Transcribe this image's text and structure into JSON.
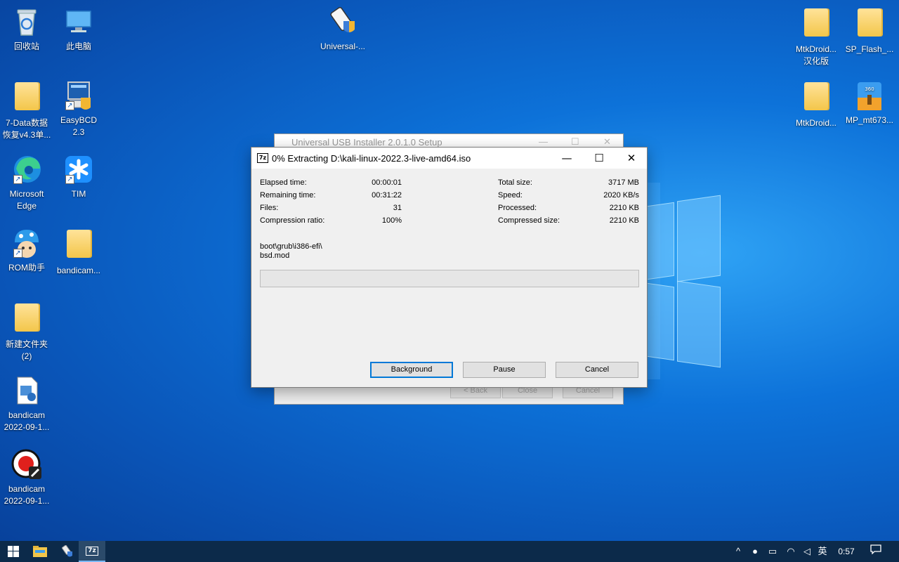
{
  "desktop": {
    "icons": [
      {
        "label": "回收站"
      },
      {
        "label": "此电脑"
      },
      {
        "label": "Universal-..."
      },
      {
        "label": "MtkDroid...\n汉化版"
      },
      {
        "label": "SP_Flash_..."
      },
      {
        "label": "7-Data数据\n恢复v4.3单..."
      },
      {
        "label": "EasyBCD\n2.3"
      },
      {
        "label": "MtkDroid..."
      },
      {
        "label": "MP_mt673..."
      },
      {
        "label": "Microsoft\nEdge"
      },
      {
        "label": "TIM"
      },
      {
        "label": "ROM助手"
      },
      {
        "label": "bandicam..."
      },
      {
        "label": "新建文件夹\n(2)"
      },
      {
        "label": "bandicam\n2022-09-1..."
      },
      {
        "label": "bandicam\n2022-09-1..."
      }
    ]
  },
  "background_window": {
    "title": "Universal USB Installer 2.0.1.0 Setup",
    "back_label": "< Back",
    "close_label": "Close",
    "cancel_label": "Cancel"
  },
  "extract_dialog": {
    "icon_text": "7z",
    "title": "0% Extracting D:\\kali-linux-2022.3-live-amd64.iso",
    "stats_left": [
      {
        "label": "Elapsed time:",
        "value": "00:00:01"
      },
      {
        "label": "Remaining time:",
        "value": "00:31:22"
      },
      {
        "label": "Files:",
        "value": "31"
      },
      {
        "label": "Compression ratio:",
        "value": "100%"
      }
    ],
    "stats_right": [
      {
        "label": "Total size:",
        "value": "3717 MB"
      },
      {
        "label": "Speed:",
        "value": "2020 KB/s"
      },
      {
        "label": "Processed:",
        "value": "2210 KB"
      },
      {
        "label": "Compressed size:",
        "value": "2210 KB"
      }
    ],
    "current_path": "boot\\grub\\i386-efi\\",
    "current_file": "bsd.mod",
    "progress": 0,
    "background_label": "Background",
    "pause_label": "Pause",
    "cancel_label": "Cancel"
  },
  "taskbar": {
    "ime_label": "英",
    "clock": "0:57",
    "active_app_label": "7z"
  }
}
